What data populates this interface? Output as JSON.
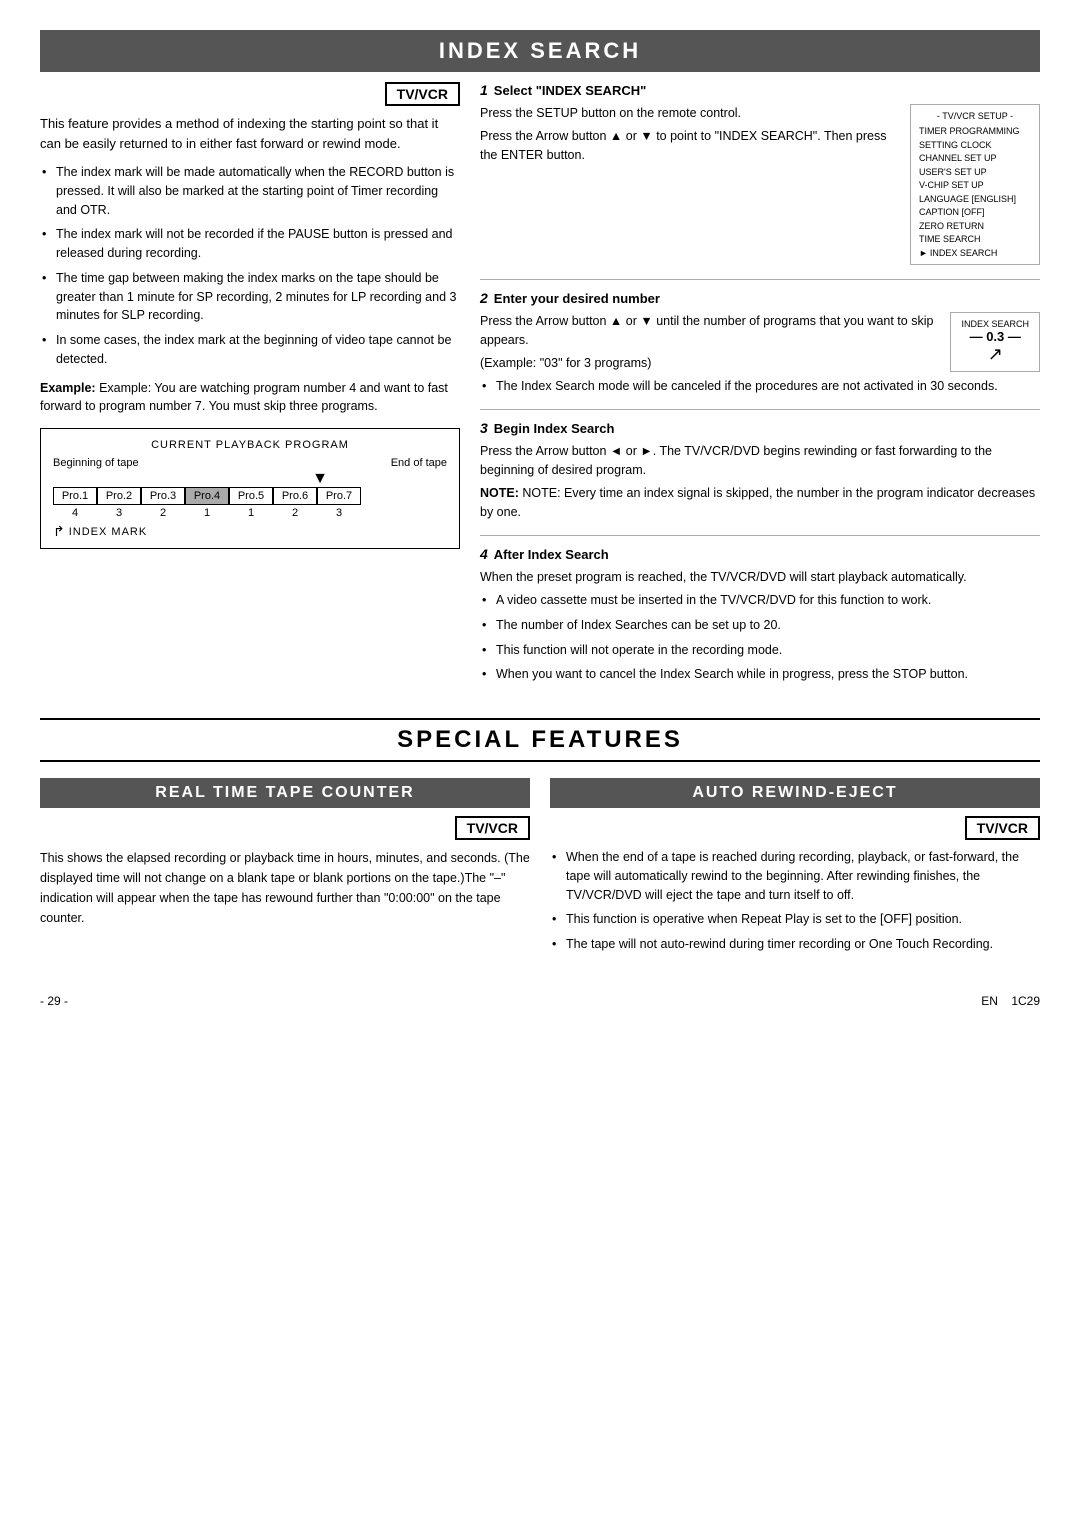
{
  "page": {
    "index_search": {
      "title": "INDEX SEARCH",
      "tv_vcr_badge": "TV/VCR",
      "intro": "This feature provides a method of indexing the starting point so that it can be easily returned to in either fast forward or rewind mode.",
      "bullets": [
        "The index mark will be made automatically when the RECORD button is pressed. It will also be marked at the starting point of Timer recording and OTR.",
        "The index mark will not be recorded if the PAUSE button is pressed and released during recording.",
        "The time gap between making the index marks on the tape should be greater than 1 minute for SP recording, 2 minutes for LP recording and 3 minutes for SLP recording.",
        "In some cases, the index mark at the beginning of video tape cannot be detected."
      ],
      "example": "Example: You are watching program number 4 and want to fast forward to program number 7. You must skip three programs.",
      "diagram": {
        "title": "CURRENT PLAYBACK PROGRAM",
        "beginning_label": "Beginning of tape",
        "end_label": "End of tape",
        "programs": [
          "Pro.1",
          "Pro.2",
          "Pro.3",
          "Pro.4",
          "Pro.5",
          "Pro.6",
          "Pro.7"
        ],
        "highlighted_index": 3,
        "numbers": [
          "4",
          "3",
          "2",
          "1",
          "1",
          "2",
          "3"
        ],
        "index_mark_label": "INDEX MARK"
      },
      "steps": {
        "step1": {
          "number": "1",
          "header": "Select \"INDEX SEARCH\"",
          "body": "Press the SETUP button on the remote control.",
          "body2": "Press the Arrow button ▲ or ▼ to point to \"INDEX SEARCH\". Then press the ENTER button.",
          "menu": {
            "title": "- TV/VCR SETUP -",
            "items": [
              "TIMER PROGRAMMING",
              "SETTING CLOCK",
              "CHANNEL SET UP",
              "USER'S SET UP",
              "V-CHIP SET UP",
              "LANGUAGE [ENGLISH]",
              "CAPTION [OFF]",
              "ZERO RETURN",
              "TIME SEARCH",
              "INDEX SEARCH"
            ],
            "selected": "INDEX SEARCH"
          }
        },
        "step2": {
          "number": "2",
          "header": "Enter your desired number",
          "body": "Press the Arrow button ▲ or ▼ until the number of programs that you want to skip appears.",
          "example": "(Example: \"03\" for 3 programs)",
          "bullet": "The Index Search mode will be canceled if the procedures are not activated in 30 seconds.",
          "display": {
            "label": "INDEX SEARCH",
            "value": "— 0.3 —"
          }
        },
        "step3": {
          "number": "3",
          "header": "Begin Index Search",
          "body": "Press the Arrow button ◄ or ►. The TV/VCR/DVD begins rewinding or fast forwarding to the beginning of desired program.",
          "note": "NOTE: Every time an index signal is skipped, the number in the program indicator decreases by one."
        },
        "step4": {
          "number": "4",
          "header": "After Index Search",
          "body": "When the preset program is reached, the TV/VCR/DVD will start playback automatically.",
          "bullets": [
            "A video cassette must be inserted in the TV/VCR/DVD for this function to work.",
            "The number of Index Searches can be set up to 20.",
            "This function will not operate in the recording mode.",
            "When you want to cancel the Index Search while in progress, press the STOP button."
          ]
        }
      }
    },
    "special_features": {
      "title": "SPECIAL FEATURES",
      "real_time_tape_counter": {
        "header": "REAL TIME TAPE COUNTER",
        "tv_vcr_badge": "TV/VCR",
        "body": "This shows the elapsed recording or playback time in hours, minutes, and seconds. (The displayed time will not change on a blank tape or blank portions on the tape.)The \"–\" indication will appear when the tape has rewound further than \"0:00:00\" on the tape counter."
      },
      "auto_rewind_eject": {
        "header": "AUTO REWIND-EJECT",
        "tv_vcr_badge": "TV/VCR",
        "bullets": [
          "When the end of a tape is reached during recording, playback, or fast-forward, the tape will automatically rewind to the beginning. After rewinding finishes, the TV/VCR/DVD will eject the tape and turn itself to off.",
          "This function is operative when Repeat Play is set to the [OFF] position.",
          "The tape will not auto-rewind during timer recording or One Touch Recording."
        ]
      }
    },
    "footer": {
      "page_number": "- 29 -",
      "language": "EN",
      "code": "1C29"
    }
  }
}
